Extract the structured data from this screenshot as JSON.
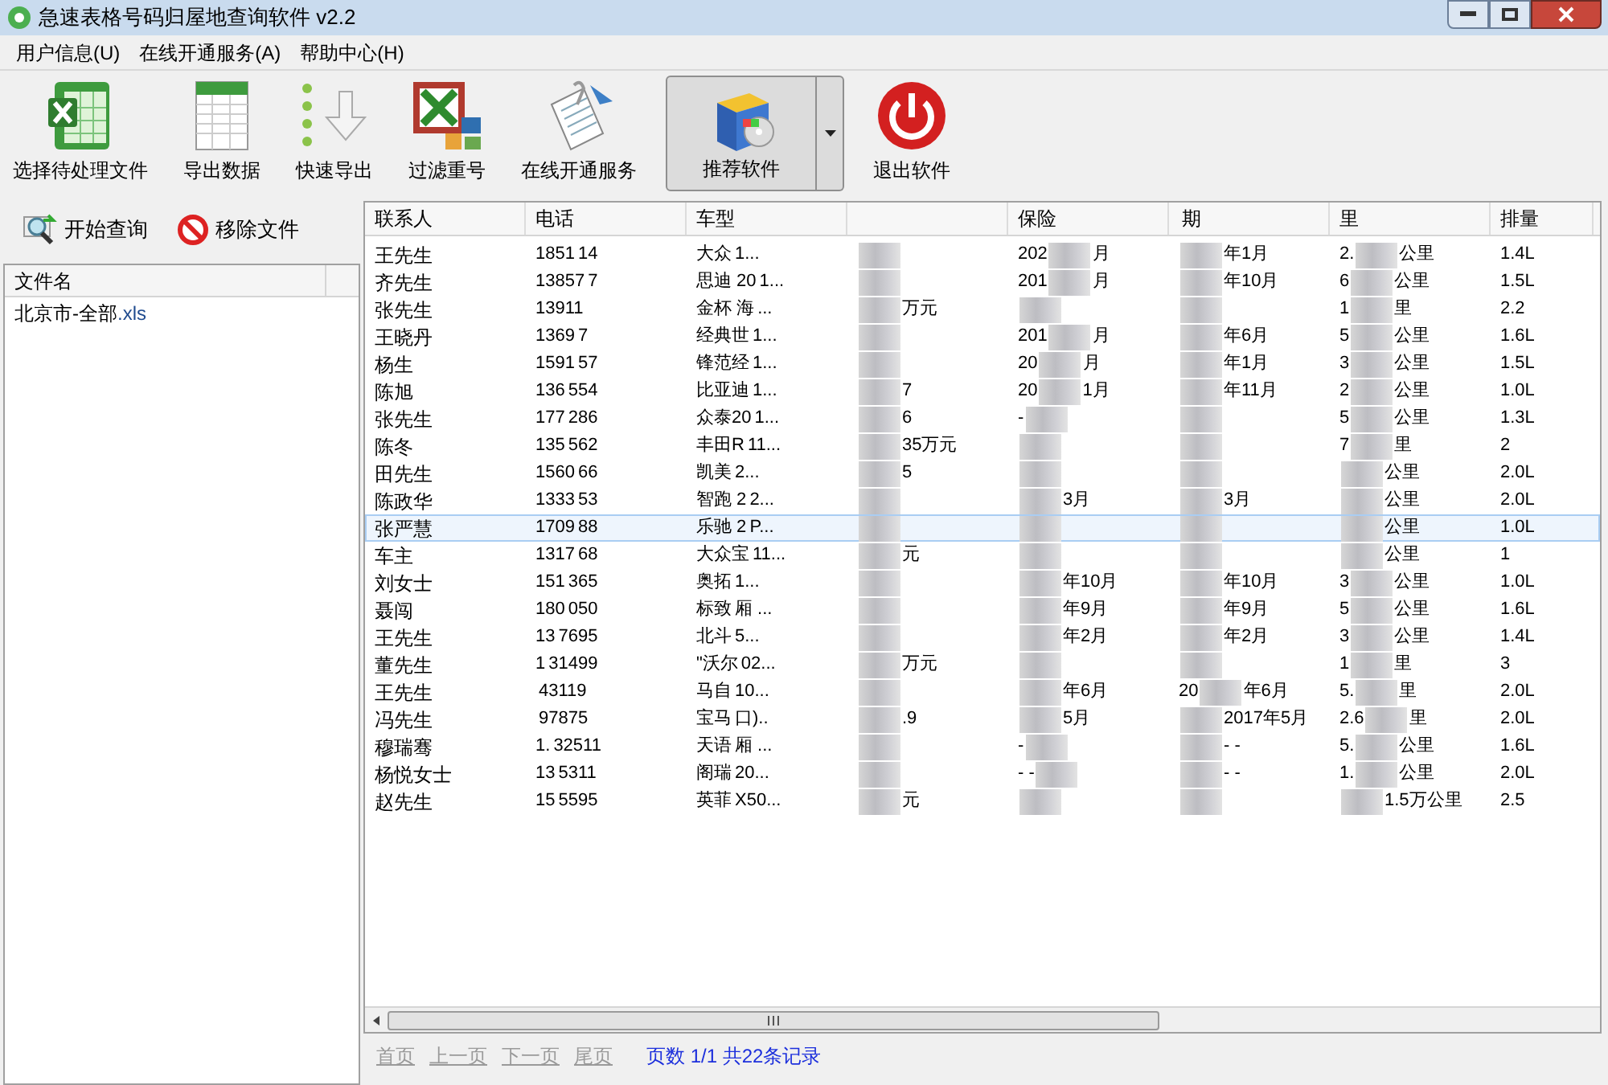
{
  "window": {
    "title": "急速表格号码归屋地查询软件 v2.2"
  },
  "menu": [
    "用户信息(U)",
    "在线开通服务(A)",
    "帮助中心(H)"
  ],
  "toolbar": [
    {
      "kind": "excel",
      "label": "选择待处理文件",
      "pressed": false,
      "dropdown": false
    },
    {
      "kind": "sheet",
      "label": "导出数据",
      "pressed": false,
      "dropdown": false
    },
    {
      "kind": "fast",
      "label": "快速导出",
      "pressed": false,
      "dropdown": false
    },
    {
      "kind": "filter",
      "label": "过滤重号",
      "pressed": false,
      "dropdown": false
    },
    {
      "kind": "doc",
      "label": "在线开通服务",
      "pressed": false,
      "dropdown": false
    },
    {
      "kind": "box",
      "label": "推荐软件",
      "pressed": true,
      "dropdown": true
    },
    {
      "kind": "power",
      "label": "退出软件",
      "pressed": false,
      "dropdown": false
    }
  ],
  "side_actions": [
    {
      "kind": "search",
      "label": "开始查询"
    },
    {
      "kind": "remove",
      "label": "移除文件"
    }
  ],
  "files": {
    "column": "文件名",
    "rows": [
      {
        "name": "北京市-全部",
        "ext": ".xls"
      }
    ]
  },
  "table": {
    "columns": [
      "联系人",
      "电话",
      {
        "kind": "masked",
        "before": "车型"
      },
      {
        "kind": "masked"
      },
      {
        "kind": "masked",
        "before": "保险"
      },
      {
        "kind": "masked",
        "after": "期"
      },
      {
        "kind": "masked",
        "before": "里"
      },
      "排量"
    ],
    "rows": [
      {
        "selected": false,
        "cells": [
          "王先生",
          {
            "kind": "masked",
            "before": "1851",
            "after": "14"
          },
          {
            "kind": "masked",
            "before": "大众",
            "after": "1..."
          },
          {
            "kind": "masked"
          },
          {
            "kind": "masked",
            "before": "202",
            "after": "月"
          },
          {
            "kind": "masked",
            "after": "年1月"
          },
          {
            "kind": "masked",
            "before": "2.",
            "after": "公里"
          },
          "1.4L"
        ]
      },
      {
        "selected": false,
        "cells": [
          "齐先生",
          {
            "kind": "masked",
            "before": "13857",
            "after": "7"
          },
          {
            "kind": "masked",
            "before": "思迪 20",
            "after": "1..."
          },
          {
            "kind": "masked"
          },
          {
            "kind": "masked",
            "before": "201",
            "after": "月"
          },
          {
            "kind": "masked",
            "after": "年10月"
          },
          {
            "kind": "masked",
            "before": "6",
            "after": "公里"
          },
          "1.5L"
        ]
      },
      {
        "selected": false,
        "cells": [
          "张先生",
          {
            "kind": "masked",
            "before": "13911"
          },
          {
            "kind": "masked",
            "before": "金杯 海",
            "after": "..."
          },
          {
            "kind": "masked",
            "after": "万元"
          },
          {
            "kind": "masked"
          },
          {
            "kind": "masked"
          },
          {
            "kind": "masked",
            "before": "1",
            "after": "里"
          },
          "2.2"
        ]
      },
      {
        "selected": false,
        "cells": [
          "王晓丹",
          {
            "kind": "masked",
            "before": "1369",
            "after": "7"
          },
          {
            "kind": "masked",
            "before": "经典世",
            "after": "1..."
          },
          {
            "kind": "masked"
          },
          {
            "kind": "masked",
            "before": "201",
            "after": "月"
          },
          {
            "kind": "masked",
            "after": "年6月"
          },
          {
            "kind": "masked",
            "before": "5",
            "after": "公里"
          },
          "1.6L"
        ]
      },
      {
        "selected": false,
        "cells": [
          "杨生",
          {
            "kind": "masked",
            "before": "1591",
            "after": "57"
          },
          {
            "kind": "masked",
            "before": "锋范经",
            "after": "1..."
          },
          {
            "kind": "masked"
          },
          {
            "kind": "masked",
            "before": "20",
            "after": "月"
          },
          {
            "kind": "masked",
            "after": "年1月"
          },
          {
            "kind": "masked",
            "before": "3",
            "after": "公里"
          },
          "1.5L"
        ]
      },
      {
        "selected": false,
        "cells": [
          "陈旭",
          {
            "kind": "masked",
            "before": "136",
            "after": "554"
          },
          {
            "kind": "masked",
            "before": "比亚迪",
            "after": "1..."
          },
          {
            "kind": "masked",
            "after": "7"
          },
          {
            "kind": "masked",
            "before": "20",
            "after": "1月"
          },
          {
            "kind": "masked",
            "after": "年11月"
          },
          {
            "kind": "masked",
            "before": "2",
            "after": "公里"
          },
          "1.0L"
        ]
      },
      {
        "selected": false,
        "cells": [
          "张先生",
          {
            "kind": "masked",
            "before": "177",
            "after": "286"
          },
          {
            "kind": "masked",
            "before": "众泰20",
            "after": "1..."
          },
          {
            "kind": "masked",
            "after": "6"
          },
          {
            "kind": "masked",
            "before": "-"
          },
          {
            "kind": "masked"
          },
          {
            "kind": "masked",
            "before": "5",
            "after": "公里"
          },
          "1.3L"
        ]
      },
      {
        "selected": false,
        "cells": [
          "陈冬",
          {
            "kind": "masked",
            "before": "135",
            "after": "562"
          },
          {
            "kind": "masked",
            "before": "丰田R",
            "after": "11..."
          },
          {
            "kind": "masked",
            "after": "35万元"
          },
          {
            "kind": "masked"
          },
          {
            "kind": "masked"
          },
          {
            "kind": "masked",
            "before": "7",
            "after": "里"
          },
          "2"
        ]
      },
      {
        "selected": false,
        "cells": [
          "田先生",
          {
            "kind": "masked",
            "before": "1560",
            "after": "66"
          },
          {
            "kind": "masked",
            "before": "凯美",
            "after": "2..."
          },
          {
            "kind": "masked",
            "after": "5"
          },
          {
            "kind": "masked"
          },
          {
            "kind": "masked"
          },
          {
            "kind": "masked",
            "after": "公里"
          },
          "2.0L"
        ]
      },
      {
        "selected": false,
        "cells": [
          "陈政华",
          {
            "kind": "masked",
            "before": "1333",
            "after": "53"
          },
          {
            "kind": "masked",
            "before": "智跑 2",
            "after": "2..."
          },
          {
            "kind": "masked"
          },
          {
            "kind": "masked",
            "after": "3月"
          },
          {
            "kind": "masked",
            "after": "3月"
          },
          {
            "kind": "masked",
            "after": "公里"
          },
          "2.0L"
        ]
      },
      {
        "selected": true,
        "cells": [
          "张严慧",
          {
            "kind": "masked",
            "before": "1709",
            "after": "88"
          },
          {
            "kind": "masked",
            "before": "乐驰 2",
            "after": "P..."
          },
          {
            "kind": "masked"
          },
          {
            "kind": "masked"
          },
          {
            "kind": "masked"
          },
          {
            "kind": "masked",
            "after": "公里"
          },
          "1.0L"
        ]
      },
      {
        "selected": false,
        "cells": [
          "车主",
          {
            "kind": "masked",
            "before": "1317",
            "after": "68"
          },
          {
            "kind": "masked",
            "before": "大众宝",
            "after": "11..."
          },
          {
            "kind": "masked",
            "after": "元"
          },
          {
            "kind": "masked"
          },
          {
            "kind": "masked"
          },
          {
            "kind": "masked",
            "after": "公里"
          },
          "1"
        ]
      },
      {
        "selected": false,
        "cells": [
          "刘女士",
          {
            "kind": "masked",
            "before": "151",
            "after": "365"
          },
          {
            "kind": "masked",
            "before": "奥拓",
            "after": "1..."
          },
          {
            "kind": "masked"
          },
          {
            "kind": "masked",
            "after": "年10月"
          },
          {
            "kind": "masked",
            "after": "年10月"
          },
          {
            "kind": "masked",
            "before": "3",
            "after": "公里"
          },
          "1.0L"
        ]
      },
      {
        "selected": false,
        "cells": [
          "聂闯",
          {
            "kind": "masked",
            "before": "180",
            "after": "050"
          },
          {
            "kind": "masked",
            "before": "标致",
            "after": "厢 ..."
          },
          {
            "kind": "masked"
          },
          {
            "kind": "masked",
            "after": "年9月"
          },
          {
            "kind": "masked",
            "after": "年9月"
          },
          {
            "kind": "masked",
            "before": "5",
            "after": "公里"
          },
          "1.6L"
        ]
      },
      {
        "selected": false,
        "cells": [
          "王先生",
          {
            "kind": "masked",
            "before": "13",
            "after": "7695"
          },
          {
            "kind": "masked",
            "before": "北斗",
            "after": "5..."
          },
          {
            "kind": "masked"
          },
          {
            "kind": "masked",
            "after": "年2月"
          },
          {
            "kind": "masked",
            "after": "年2月"
          },
          {
            "kind": "masked",
            "before": "3",
            "after": "公里"
          },
          "1.4L"
        ]
      },
      {
        "selected": false,
        "cells": [
          "董先生",
          {
            "kind": "masked",
            "before": "1",
            "after": "31499"
          },
          {
            "kind": "masked",
            "before": "\"沃尔",
            "after": "02..."
          },
          {
            "kind": "masked",
            "after": "万元"
          },
          {
            "kind": "masked"
          },
          {
            "kind": "masked"
          },
          {
            "kind": "masked",
            "before": "1",
            "after": "里"
          },
          "3"
        ]
      },
      {
        "selected": false,
        "cells": [
          "王先生",
          {
            "kind": "masked",
            "after": "43119"
          },
          {
            "kind": "masked",
            "before": "马自",
            "after": "10..."
          },
          {
            "kind": "masked"
          },
          {
            "kind": "masked",
            "after": "年6月"
          },
          {
            "kind": "masked",
            "before": "20",
            "after": "年6月"
          },
          {
            "kind": "masked",
            "before": "5.",
            "after": "里"
          },
          "2.0L"
        ]
      },
      {
        "selected": false,
        "cells": [
          "冯先生",
          {
            "kind": "masked",
            "after": "97875"
          },
          {
            "kind": "masked",
            "before": "宝马",
            "after": "口).."
          },
          {
            "kind": "masked",
            "after": ".9"
          },
          {
            "kind": "masked",
            "after": "5月"
          },
          {
            "kind": "masked",
            "after": "2017年5月"
          },
          {
            "kind": "masked",
            "before": "2.6",
            "after": "里"
          },
          "2.0L"
        ]
      },
      {
        "selected": false,
        "cells": [
          "穆瑞骞",
          {
            "kind": "masked",
            "before": "1.",
            "after": "32511"
          },
          {
            "kind": "masked",
            "before": "天语",
            "after": "厢 ..."
          },
          {
            "kind": "masked"
          },
          {
            "kind": "masked",
            "before": "-"
          },
          {
            "kind": "masked",
            "after": "- -"
          },
          {
            "kind": "masked",
            "before": "5.",
            "after": "公里"
          },
          "1.6L"
        ]
      },
      {
        "selected": false,
        "cells": [
          "杨悦女士",
          {
            "kind": "masked",
            "before": "13",
            "after": "5311"
          },
          {
            "kind": "masked",
            "before": "阁瑞",
            "after": "20..."
          },
          {
            "kind": "masked"
          },
          {
            "kind": "masked",
            "before": "- -"
          },
          {
            "kind": "masked",
            "after": "- -"
          },
          {
            "kind": "masked",
            "before": "1.",
            "after": "公里"
          },
          "2.0L"
        ]
      },
      {
        "selected": false,
        "cells": [
          "赵先生",
          {
            "kind": "masked",
            "before": "15",
            "after": "5595"
          },
          {
            "kind": "masked",
            "before": "英菲",
            "after": "X50..."
          },
          {
            "kind": "masked",
            "after": "元"
          },
          {
            "kind": "masked"
          },
          {
            "kind": "masked"
          },
          {
            "kind": "masked",
            "after": "1.5万公里"
          },
          "2.5"
        ]
      }
    ]
  },
  "pager": {
    "links": [
      "首页",
      "上一页",
      "下一页",
      "尾页"
    ],
    "summary": "页数 1/1 共22条记录"
  }
}
